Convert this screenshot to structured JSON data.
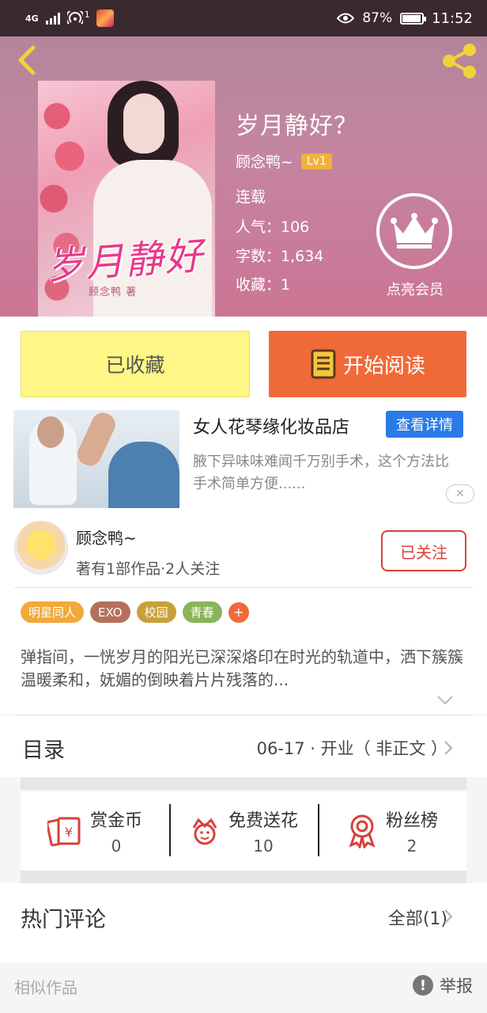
{
  "status_bar": {
    "network": "4G",
    "notification_count": "1",
    "battery_percent": "87%",
    "battery_level": 0.87,
    "time": "11:52"
  },
  "book": {
    "title": "岁月静好？",
    "cover_title": "岁月静好",
    "cover_author": "顾念鸭 著",
    "author": "顾念鸭~",
    "author_level": "Lv1",
    "status": "连载",
    "popularity": "人气：106",
    "word_count": "字数：1,634",
    "favorites": "收藏：1",
    "vip_label": "点亮会员"
  },
  "actions": {
    "favorited_label": "已收藏",
    "start_reading_label": "开始阅读"
  },
  "ad": {
    "title": "女人花琴缘化妆品店",
    "button": "查看详情",
    "description": "腋下异味味难闻千万别手术，这个方法比手术简单方便......",
    "close_icon": "close-icon"
  },
  "author_card": {
    "name": "顾念鸭~",
    "stats": "著有1部作品·2人关注",
    "follow_label": "已关注"
  },
  "tags": [
    {
      "label": "明星同人",
      "color": "#f2a93b"
    },
    {
      "label": "EXO",
      "color": "#b5705c"
    },
    {
      "label": "校园",
      "color": "#c8a03a"
    },
    {
      "label": "青春",
      "color": "#8ab45a"
    }
  ],
  "tag_add": "+",
  "description": "弹指间，一恍岁月的阳光已深深烙印在时光的轨道中，洒下簇簇温暖柔和，妩媚的倒映着片片残落的...",
  "toc": {
    "label": "目录",
    "latest": "06-17 · 开业（ 非正文 ）"
  },
  "stats": [
    {
      "label": "赏金币",
      "value": "0",
      "icon": "reward-coin-icon"
    },
    {
      "label": "免费送花",
      "value": "10",
      "icon": "flower-icon"
    },
    {
      "label": "粉丝榜",
      "value": "2",
      "icon": "medal-icon"
    }
  ],
  "comments": {
    "label": "热门评论",
    "all": "全部(1)"
  },
  "footer": {
    "similar": "相似作品",
    "report": "举报"
  },
  "colors": {
    "accent_orange": "#ef6a38",
    "favorite_yellow": "#fef685",
    "ad_blue": "#2b7be6",
    "follow_red": "#d9403a",
    "level_badge": "#f2b23a"
  }
}
